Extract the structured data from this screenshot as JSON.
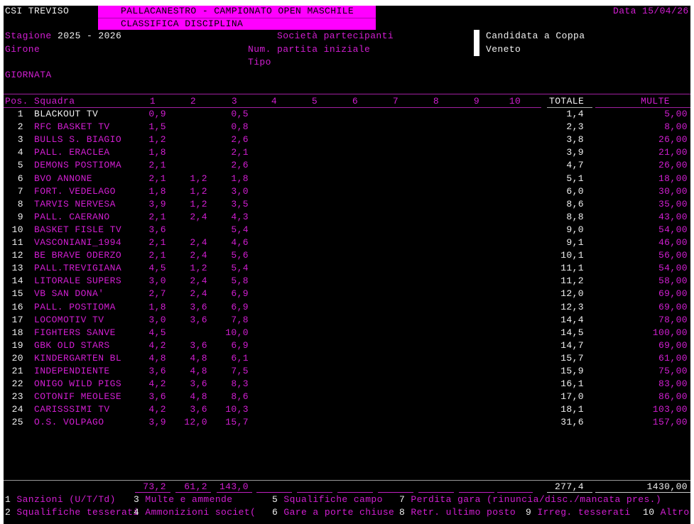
{
  "header": {
    "org": "CSI TREVISO",
    "title": "PALLACANESTRO - CAMPIONATO OPEN MASCHILE",
    "subtitle": "CLASSIFICA DISCIPLINA",
    "date": "Data 15/04/26"
  },
  "info": {
    "stagione_label": "Stagione",
    "stagione_value": "2025 - 2026",
    "girone_label": "Girone",
    "giornata_label": "GIORNATA",
    "societa_label": "Società partecipanti",
    "partita_label": "Num. partita iniziale",
    "tipo_label": "Tipo",
    "candidata_line1": "Candidata a Coppa",
    "candidata_line2": "Veneto"
  },
  "table": {
    "col_pos": "Pos.",
    "col_squadra": "Squadra",
    "num_cols": [
      "1",
      "2",
      "3",
      "4",
      "5",
      "6",
      "7",
      "8",
      "9",
      "10"
    ],
    "col_totale": "TOTALE",
    "col_multe": "MULTE",
    "rows": [
      {
        "pos": "1",
        "name": "BLACKOUT TV",
        "c1": "0,9",
        "c2": "",
        "c3": "0,5",
        "tot": "1,4",
        "multe": "5,00"
      },
      {
        "pos": "2",
        "name": "RFC BASKET TV",
        "c1": "1,5",
        "c2": "",
        "c3": "0,8",
        "tot": "2,3",
        "multe": "8,00"
      },
      {
        "pos": "3",
        "name": "BULLS S. BIAGIO",
        "c1": "1,2",
        "c2": "",
        "c3": "2,6",
        "tot": "3,8",
        "multe": "26,00"
      },
      {
        "pos": "4",
        "name": "PALL. ERACLEA",
        "c1": "1,8",
        "c2": "",
        "c3": "2,1",
        "tot": "3,9",
        "multe": "21,00"
      },
      {
        "pos": "5",
        "name": "DEMONS POSTIOMA",
        "c1": "2,1",
        "c2": "",
        "c3": "2,6",
        "tot": "4,7",
        "multe": "26,00"
      },
      {
        "pos": "6",
        "name": "BVO ANNONE",
        "c1": "2,1",
        "c2": "1,2",
        "c3": "1,8",
        "tot": "5,1",
        "multe": "18,00"
      },
      {
        "pos": "7",
        "name": "FORT. VEDELAGO",
        "c1": "1,8",
        "c2": "1,2",
        "c3": "3,0",
        "tot": "6,0",
        "multe": "30,00"
      },
      {
        "pos": "8",
        "name": "TARVIS NERVESA",
        "c1": "3,9",
        "c2": "1,2",
        "c3": "3,5",
        "tot": "8,6",
        "multe": "35,00"
      },
      {
        "pos": "9",
        "name": "PALL. CAERANO",
        "c1": "2,1",
        "c2": "2,4",
        "c3": "4,3",
        "tot": "8,8",
        "multe": "43,00"
      },
      {
        "pos": "10",
        "name": "BASKET FISLE TV",
        "c1": "3,6",
        "c2": "",
        "c3": "5,4",
        "tot": "9,0",
        "multe": "54,00"
      },
      {
        "pos": "11",
        "name": "VASCONIANI_1994",
        "c1": "2,1",
        "c2": "2,4",
        "c3": "4,6",
        "tot": "9,1",
        "multe": "46,00"
      },
      {
        "pos": "12",
        "name": "BE BRAVE ODERZO",
        "c1": "2,1",
        "c2": "2,4",
        "c3": "5,6",
        "tot": "10,1",
        "multe": "56,00"
      },
      {
        "pos": "13",
        "name": "PALL.TREVIGIANA",
        "c1": "4,5",
        "c2": "1,2",
        "c3": "5,4",
        "tot": "11,1",
        "multe": "54,00"
      },
      {
        "pos": "14",
        "name": "LITORALE SUPERS",
        "c1": "3,0",
        "c2": "2,4",
        "c3": "5,8",
        "tot": "11,2",
        "multe": "58,00"
      },
      {
        "pos": "15",
        "name": "VB SAN DONA'",
        "c1": "2,7",
        "c2": "2,4",
        "c3": "6,9",
        "tot": "12,0",
        "multe": "69,00"
      },
      {
        "pos": "16",
        "name": "PALL. POSTIOMA",
        "c1": "1,8",
        "c2": "3,6",
        "c3": "6,9",
        "tot": "12,3",
        "multe": "69,00"
      },
      {
        "pos": "17",
        "name": "LOCOMOTIV TV",
        "c1": "3,0",
        "c2": "3,6",
        "c3": "7,8",
        "tot": "14,4",
        "multe": "78,00"
      },
      {
        "pos": "18",
        "name": "FIGHTERS SANVE",
        "c1": "4,5",
        "c2": "",
        "c3": "10,0",
        "tot": "14,5",
        "multe": "100,00"
      },
      {
        "pos": "19",
        "name": "GBK OLD STARS",
        "c1": "4,2",
        "c2": "3,6",
        "c3": "6,9",
        "tot": "14,7",
        "multe": "69,00"
      },
      {
        "pos": "20",
        "name": "KINDERGARTEN BL",
        "c1": "4,8",
        "c2": "4,8",
        "c3": "6,1",
        "tot": "15,7",
        "multe": "61,00"
      },
      {
        "pos": "21",
        "name": "INDEPENDIENTE",
        "c1": "3,6",
        "c2": "4,8",
        "c3": "7,5",
        "tot": "15,9",
        "multe": "75,00"
      },
      {
        "pos": "22",
        "name": "ONIGO WILD PIGS",
        "c1": "4,2",
        "c2": "3,6",
        "c3": "8,3",
        "tot": "16,1",
        "multe": "83,00"
      },
      {
        "pos": "23",
        "name": "COTONIF MEOLESE",
        "c1": "3,6",
        "c2": "4,8",
        "c3": "8,6",
        "tot": "17,0",
        "multe": "86,00"
      },
      {
        "pos": "24",
        "name": "CARISSSIMI TV",
        "c1": "4,2",
        "c2": "3,6",
        "c3": "10,3",
        "tot": "18,1",
        "multe": "103,00"
      },
      {
        "pos": "25",
        "name": "O.S. VOLPAGO",
        "c1": "3,9",
        "c2": "12,0",
        "c3": "15,7",
        "tot": "31,6",
        "multe": "157,00"
      }
    ],
    "totals": {
      "c1": "73,2",
      "c2": "61,2",
      "c3": "143,0",
      "tot": "277,4",
      "multe": "1430,00"
    }
  },
  "legend": [
    {
      "num": "1",
      "label": "Sanzioni (U/T/Td)"
    },
    {
      "num": "3",
      "label": "Multe e ammende"
    },
    {
      "num": "5",
      "label": "Squalifiche campo"
    },
    {
      "num": "7",
      "label": "Perdita gara (rinuncia/disc./mancata pres.)"
    },
    {
      "num": "2",
      "label": "Squalifiche tesserati"
    },
    {
      "num": "4",
      "label": "Ammonizioni societ("
    },
    {
      "num": "6",
      "label": "Gare a porte chiuse"
    },
    {
      "num": "8",
      "label": "Retr. ultimo posto"
    },
    {
      "num": "9",
      "label": "Irreg. tesserati"
    },
    {
      "num": "10",
      "label": "Altro"
    }
  ]
}
